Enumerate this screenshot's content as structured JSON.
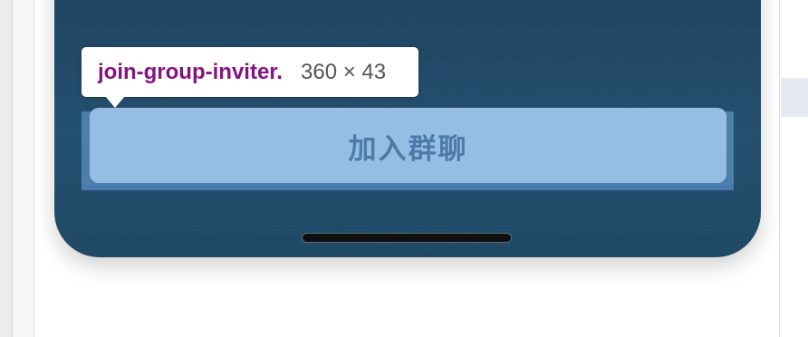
{
  "inspector": {
    "element_name": "join-group-inviter.",
    "dimensions": "360 × 43"
  },
  "main": {
    "join_button_label": "加入群聊"
  },
  "colors": {
    "background": "#1f4a69",
    "button_fill": "#96bee4",
    "button_text": "#4d7aa6",
    "highlight": "#6fa8dc",
    "tooltip_name": "#881280"
  }
}
